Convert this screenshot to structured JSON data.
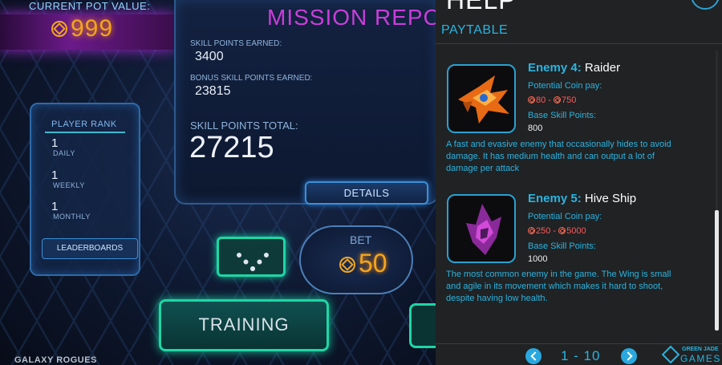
{
  "game": {
    "pot_label": "CURRENT POT VALUE:",
    "pot_value": "999",
    "mission_title": "MISSION REPO",
    "skill_points_label": "SKILL POINTS EARNED:",
    "skill_points_value": "3400",
    "bonus_label": "BONUS SKILL POINTS EARNED:",
    "bonus_value": "23815",
    "total_label": "SKILL POINTS TOTAL:",
    "total_value": "27215",
    "details_label": "DETAILS",
    "rank": {
      "title": "PLAYER RANK",
      "daily_num": "1",
      "daily_label": "DAILY",
      "weekly_num": "1",
      "weekly_label": "WEEKLY",
      "monthly_num": "1",
      "monthly_label": "MONTHLY",
      "leaderboards_label": "LEADERBOARDS"
    },
    "bet_label": "BET",
    "bet_value": "50",
    "training_label": "TRAINING",
    "game_name": "GALAXY ROGUES"
  },
  "help": {
    "title": "HELP",
    "tab": "PAYTABLE",
    "coin_pay_label": "Potential Coin pay:",
    "skill_label": "Base Skill Points:",
    "enemies": [
      {
        "num_label": "Enemy 4:",
        "name": "Raider",
        "pay_min": "80",
        "pay_max": "750",
        "skill": "800",
        "description": "A fast and evasive enemy that occasionally hides to avoid damage. It has medium health and can output a lot of damage per attack"
      },
      {
        "num_label": "Enemy 5:",
        "name": "Hive Ship",
        "pay_min": "250",
        "pay_max": "5000",
        "skill": "1000",
        "description": "The most common enemy in the game.  The Wing is small and agile in its movement which makes it hard to shoot, despite having low health."
      }
    ],
    "page_label": "1 - 10",
    "brand_top": "GREEN JADE",
    "brand_bottom": "GAMES",
    "colors": {
      "accent": "#2ab4e0",
      "pay": "#ff5a5a",
      "panel_bg": "#202224"
    },
    "icons": [
      "close-icon",
      "coin-icon",
      "chevron-left-icon",
      "chevron-right-icon",
      "brand-logo-icon"
    ]
  }
}
